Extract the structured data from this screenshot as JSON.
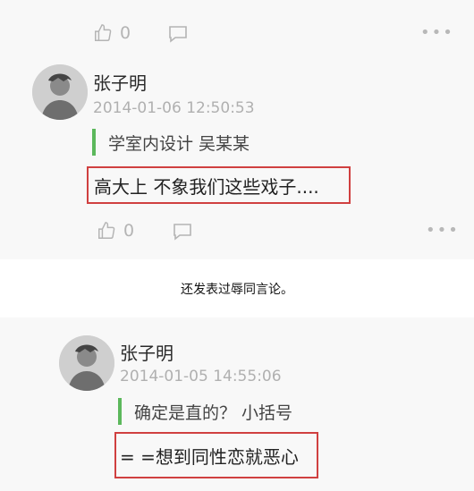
{
  "comments": [
    {
      "like_count": "0",
      "author": "",
      "time": "",
      "quote": "",
      "reply": ""
    },
    {
      "like_count": "0",
      "author": "张子明",
      "time": "2014-01-06 12:50:53",
      "quote": "学室内设计 吴某某",
      "reply": "高大上 不象我们这些戏子...."
    },
    {
      "like_count": "",
      "author": "张子明",
      "time": "2014-01-05 14:55:06",
      "quote": "确定是直的？ 小括号",
      "reply": "= =想到同性恋就恶心"
    }
  ],
  "caption": "还发表过辱同言论。",
  "icons": [
    "thumbs-up-icon",
    "comment-icon",
    "more-dots-icon",
    "avatar"
  ],
  "colors": {
    "quote_bar": "#5cb85c",
    "highlight_border": "#d04040",
    "meta_gray": "#b0b0b0"
  }
}
